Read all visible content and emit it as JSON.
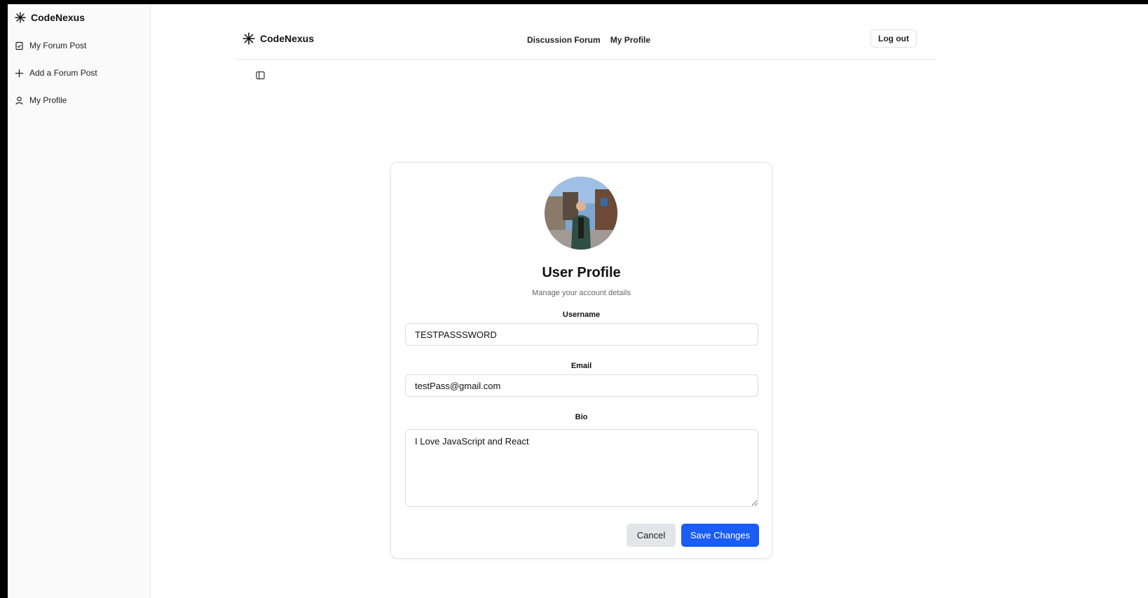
{
  "sidebar": {
    "brand": "CodeNexus",
    "items": [
      {
        "label": "My Forum Post",
        "icon": "clipboard-icon"
      },
      {
        "label": "Add a Forum Post",
        "icon": "plus-icon"
      },
      {
        "label": "My Profile",
        "icon": "user-icon"
      }
    ]
  },
  "header": {
    "brand": "CodeNexus",
    "nav": [
      "Discussion Forum",
      "My Profile"
    ],
    "logout_label": "Log out"
  },
  "profile": {
    "title": "User Profile",
    "subtitle": "Manage your account details",
    "fields": {
      "username": {
        "label": "Username",
        "value": "TESTPASSSWORD"
      },
      "email": {
        "label": "Email",
        "value": "testPass@gmail.com"
      },
      "bio": {
        "label": "Bio",
        "value": "I Love JavaScript and React"
      }
    },
    "cancel_label": "Cancel",
    "save_label": "Save Changes"
  },
  "colors": {
    "accent": "#1a5cf5",
    "cancel_bg": "#e3e5e8"
  }
}
